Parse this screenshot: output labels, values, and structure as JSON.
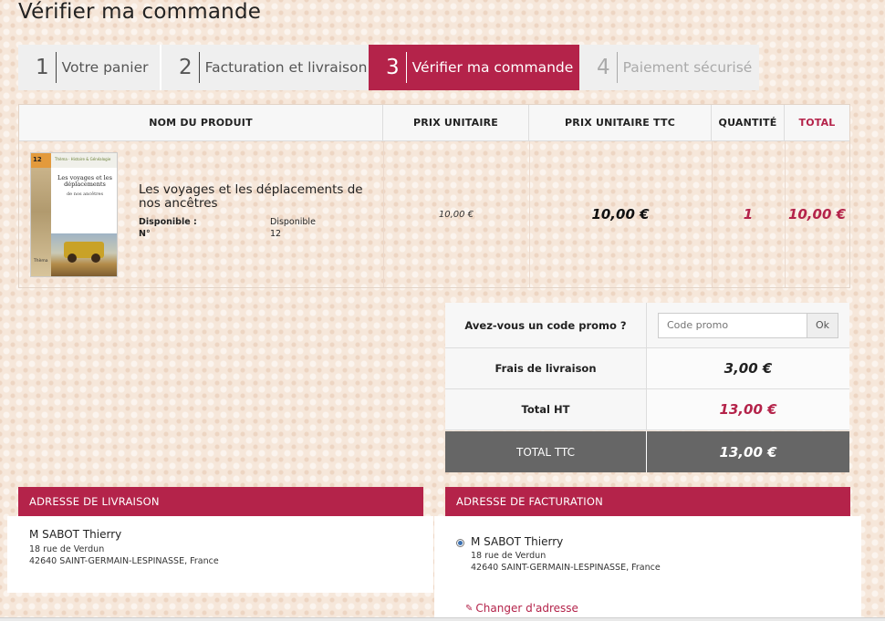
{
  "page_title": "Vérifier ma commande",
  "steps": [
    {
      "num": "1",
      "label": "Votre panier"
    },
    {
      "num": "2",
      "label": "Facturation et livraison"
    },
    {
      "num": "3",
      "label": "Vérifier ma commande"
    },
    {
      "num": "4",
      "label": "Paiement sécurisé"
    }
  ],
  "table": {
    "headers": {
      "product": "NOM DU PRODUIT",
      "unit_price": "PRIX UNITAIRE",
      "unit_price_ttc": "PRIX UNITAIRE TTC",
      "quantity": "QUANTITÉ",
      "total": "TOTAL"
    },
    "row": {
      "name": "Les voyages et les déplacements de nos ancêtres",
      "attr1_label": "Disponible :",
      "attr1_value": "Disponible",
      "attr2_label": "N°",
      "attr2_value": "12",
      "unit_price": "10,00 €",
      "unit_price_ttc": "10,00 €",
      "quantity": "1",
      "total": "10,00 €",
      "cover": {
        "number": "12",
        "series": "Thèma · Histoire & Généalogie",
        "title": "Les voyages et les déplacements",
        "subtitle": "de nos ancêtres",
        "brand": "Thèma"
      }
    }
  },
  "promo": {
    "label": "Avez-vous un code promo ?",
    "placeholder": "Code promo",
    "button": "Ok"
  },
  "summary": {
    "shipping_label": "Frais de livraison",
    "shipping_value": "3,00 €",
    "total_ht_label": "Total HT",
    "total_ht_value": "13,00 €",
    "total_ttc_label": "TOTAL TTC",
    "total_ttc_value": "13,00 €"
  },
  "delivery": {
    "header": "ADRESSE DE LIVRAISON",
    "name": "M SABOT Thierry",
    "street": "18 rue de Verdun",
    "city": "42640 SAINT-GERMAIN-LESPINASSE, France"
  },
  "billing": {
    "header": "ADRESSE DE FACTURATION",
    "name": "M SABOT Thierry",
    "street": "18 rue de Verdun",
    "city": "42640 SAINT-GERMAIN-LESPINASSE, France",
    "change_link": "Changer d'adresse"
  },
  "colors": {
    "accent": "#b4234a",
    "dark_gray": "#666666",
    "background": "#f6e7da"
  }
}
